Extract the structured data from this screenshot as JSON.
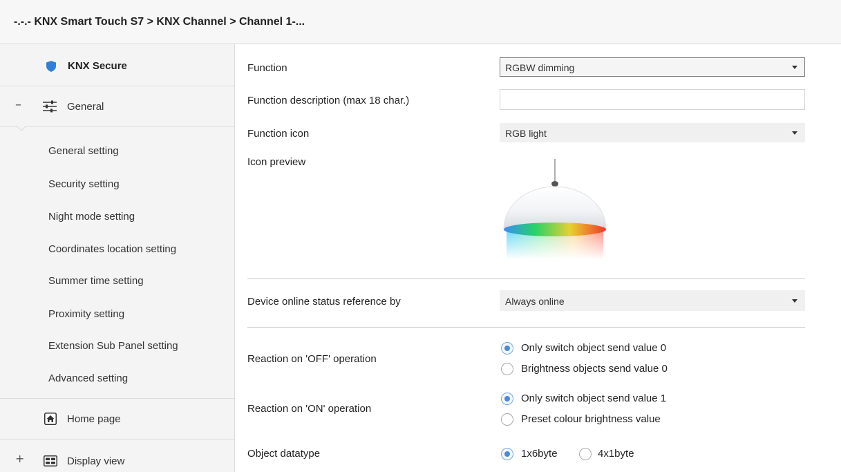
{
  "breadcrumb": {
    "text": "-.-.- KNX Smart Touch S7 > KNX Channel  > Channel 1-..."
  },
  "sidebar": {
    "knx_secure": "KNX Secure",
    "general": {
      "toggle": "–",
      "label": "General"
    },
    "items": [
      "General setting",
      "Security setting",
      "Night mode setting",
      "Coordinates location setting",
      "Summer time setting",
      "Proximity setting",
      "Extension Sub Panel setting",
      "Advanced setting"
    ],
    "home_page": "Home page",
    "display_view": {
      "toggle": "+",
      "label": "Display view"
    }
  },
  "form": {
    "function": {
      "label": "Function",
      "value": "RGBW dimming"
    },
    "function_description": {
      "label": "Function description (max 18 char.)",
      "value": ""
    },
    "function_icon": {
      "label": "Function icon",
      "value": "RGB light"
    },
    "icon_preview": {
      "label": "Icon preview",
      "icon": "rgb-pendant-lamp-icon"
    },
    "online_status": {
      "label": "Device online status reference by",
      "value": "Always online"
    },
    "reaction_off": {
      "label": "Reaction on 'OFF' operation",
      "options": [
        "Only switch object send value 0",
        "Brightness objects send value 0"
      ],
      "selected": 0
    },
    "reaction_on": {
      "label": "Reaction on 'ON' operation",
      "options": [
        "Only switch object send value 1",
        "Preset colour brightness value"
      ],
      "selected": 0
    },
    "object_datatype": {
      "label": "Object datatype",
      "options": [
        "1x6byte",
        "4x1byte"
      ],
      "selected": 0
    }
  },
  "colors": {
    "accent": "#4a8bd4",
    "shield": "#2f7fd8"
  }
}
